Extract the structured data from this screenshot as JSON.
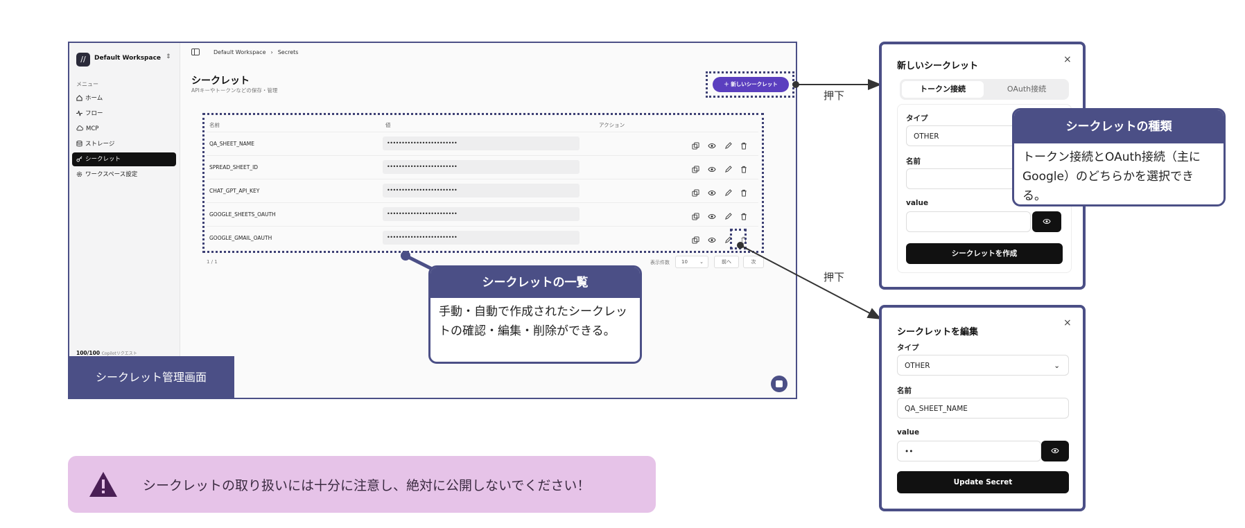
{
  "sidebar": {
    "workspace_name": "Default Workspace",
    "menu_label": "メニュー",
    "items": [
      {
        "label": "ホーム",
        "icon": "home-icon"
      },
      {
        "label": "フロー",
        "icon": "activity-icon"
      },
      {
        "label": "MCP",
        "icon": "cloud-icon"
      },
      {
        "label": "ストレージ",
        "icon": "database-icon"
      },
      {
        "label": "シークレット",
        "icon": "key-icon",
        "active": true
      },
      {
        "label": "ワークスペース設定",
        "icon": "gear-icon"
      }
    ],
    "credits_value": "100/100",
    "credits_label": "Copilotリクエスト"
  },
  "header": {
    "breadcrumb": [
      "Default Workspace",
      "Secrets"
    ],
    "title": "シークレット",
    "subtitle": "APIキーやトークンなどの保存・管理",
    "new_button": "＋ 新しいシークレット"
  },
  "table": {
    "columns": [
      "名前",
      "値",
      "アクション"
    ],
    "rows": [
      {
        "name": "QA_SHEET_NAME",
        "value": "••••••••••••••••••••••••"
      },
      {
        "name": "SPREAD_SHEET_ID",
        "value": "••••••••••••••••••••••••"
      },
      {
        "name": "CHAT_GPT_API_KEY",
        "value": "••••••••••••••••••••••••"
      },
      {
        "name": "GOOGLE_SHEETS_OAUTH",
        "value": "••••••••••••••••••••••••"
      },
      {
        "name": "GOOGLE_GMAIL_OAUTH",
        "value": "••••••••••••••••••••••••"
      }
    ],
    "pagination": {
      "page": "1 / 1",
      "per_page_label": "表示件数",
      "per_page": "10",
      "prev": "前へ",
      "next": "次"
    }
  },
  "main_caption": "シークレット管理画面",
  "callout_list": {
    "title": "シークレットの一覧",
    "body": "手動・自動で作成されたシークレットの確認・編集・削除ができる。"
  },
  "callout_type": {
    "title": "シークレットの種類",
    "body": "トークン接続とOAuth接続（主にGoogle）のどちらかを選択できる。"
  },
  "arrow_labels": [
    "押下",
    "押下"
  ],
  "new_modal": {
    "title": "新しいシークレット",
    "tabs": [
      "トークン接続",
      "OAuth接続"
    ],
    "type_label": "タイプ",
    "type_value": "OTHER",
    "name_label": "名前",
    "value_label": "value",
    "submit": "シークレットを作成"
  },
  "edit_modal": {
    "title": "シークレットを編集",
    "type_label": "タイプ",
    "type_value": "OTHER",
    "name_label": "名前",
    "name_value": "QA_SHEET_NAME",
    "value_label": "value",
    "value_value": "••",
    "submit": "Update Secret"
  },
  "warning": {
    "text": "シークレットの取り扱いには十分に注意し、絶対に公開しないでください！"
  },
  "colors": {
    "accent": "#4b4f86",
    "button": "#5b3fbf",
    "warning_bg": "#e6c3e8"
  }
}
